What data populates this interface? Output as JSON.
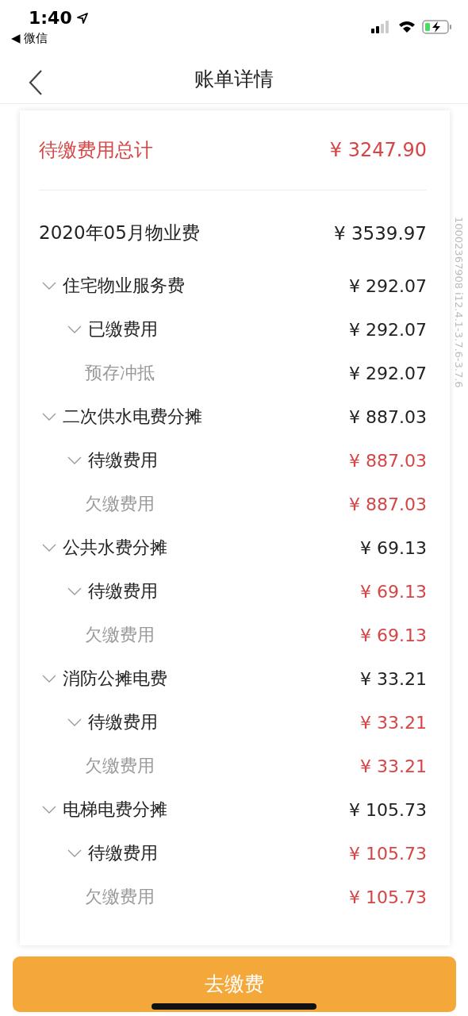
{
  "status_bar": {
    "time": "1:40",
    "back_app": "◀ 微信"
  },
  "nav": {
    "title": "账单详情"
  },
  "summary": {
    "label": "待缴费用总计",
    "amount": "¥ 3247.90"
  },
  "bill": {
    "title": "2020年05月物业费",
    "amount": "¥ 3539.97",
    "items": [
      {
        "name": "住宅物业服务费",
        "amount": "¥ 292.07",
        "expanded": true,
        "children": [
          {
            "name": "已缴费用",
            "amount": "¥ 292.07",
            "kind": "paid",
            "expanded": true,
            "children": [
              {
                "name": "预存冲抵",
                "amount": "¥ 292.07",
                "kind": "paid"
              }
            ]
          }
        ]
      },
      {
        "name": "二次供水电费分摊",
        "amount": "¥ 887.03",
        "expanded": true,
        "children": [
          {
            "name": "待缴费用",
            "amount": "¥ 887.03",
            "kind": "due",
            "expanded": true,
            "children": [
              {
                "name": "欠缴费用",
                "amount": "¥ 887.03",
                "kind": "due"
              }
            ]
          }
        ]
      },
      {
        "name": "公共水费分摊",
        "amount": "¥ 69.13",
        "expanded": true,
        "children": [
          {
            "name": "待缴费用",
            "amount": "¥ 69.13",
            "kind": "due",
            "expanded": true,
            "children": [
              {
                "name": "欠缴费用",
                "amount": "¥ 69.13",
                "kind": "due"
              }
            ]
          }
        ]
      },
      {
        "name": "消防公摊电费",
        "amount": "¥ 33.21",
        "expanded": true,
        "children": [
          {
            "name": "待缴费用",
            "amount": "¥ 33.21",
            "kind": "due",
            "expanded": true,
            "children": [
              {
                "name": "欠缴费用",
                "amount": "¥ 33.21",
                "kind": "due"
              }
            ]
          }
        ]
      },
      {
        "name": "电梯电费分摊",
        "amount": "¥ 105.73",
        "expanded": true,
        "children": [
          {
            "name": "待缴费用",
            "amount": "¥ 105.73",
            "kind": "due",
            "expanded": true,
            "children": [
              {
                "name": "欠缴费用",
                "amount": "¥ 105.73",
                "kind": "due"
              }
            ]
          }
        ]
      }
    ]
  },
  "side_label": "10002367908 i12.4.1-3.7.6-3.7.6",
  "pay_button": "去缴费"
}
